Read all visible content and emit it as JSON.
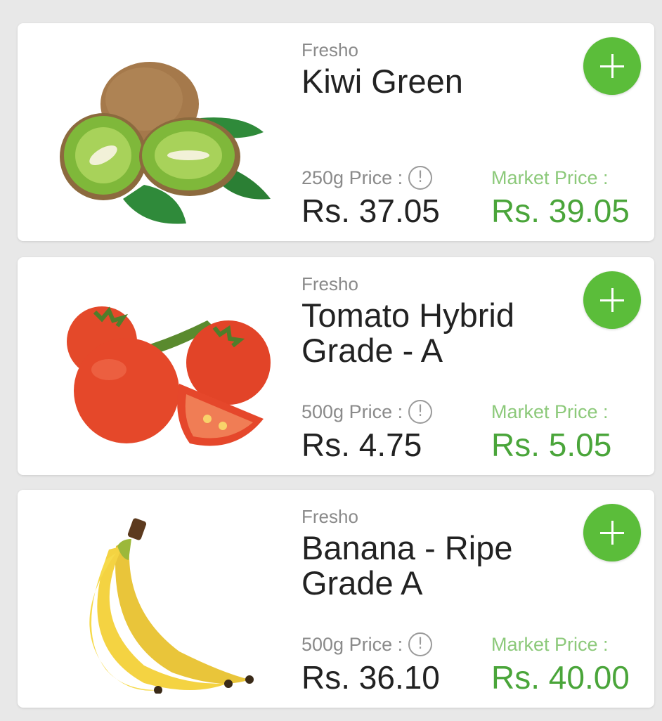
{
  "colors": {
    "accent_green": "#5bbd3a",
    "market_label": "#8cc97a",
    "market_value": "#4aa53a",
    "background": "#e8e8e8"
  },
  "products": [
    {
      "brand": "Fresho",
      "name": "Kiwi Green",
      "price_label": "250g Price :",
      "price": "Rs. 37.05",
      "market_label": "Market Price :",
      "market_price": "Rs. 39.05",
      "add_icon": "plus-icon",
      "info_icon": "info-icon",
      "info_glyph": "!"
    },
    {
      "brand": "Fresho",
      "name": "Tomato Hybrid Grade - A",
      "price_label": "500g Price :",
      "price": "Rs. 4.75",
      "market_label": "Market Price :",
      "market_price": "Rs. 5.05",
      "add_icon": "plus-icon",
      "info_icon": "info-icon",
      "info_glyph": "!"
    },
    {
      "brand": "Fresho",
      "name": "Banana - Ripe Grade A",
      "price_label": "500g Price :",
      "price": "Rs. 36.10",
      "market_label": "Market Price :",
      "market_price": "Rs. 40.00",
      "add_icon": "plus-icon",
      "info_icon": "info-icon",
      "info_glyph": "!"
    }
  ]
}
